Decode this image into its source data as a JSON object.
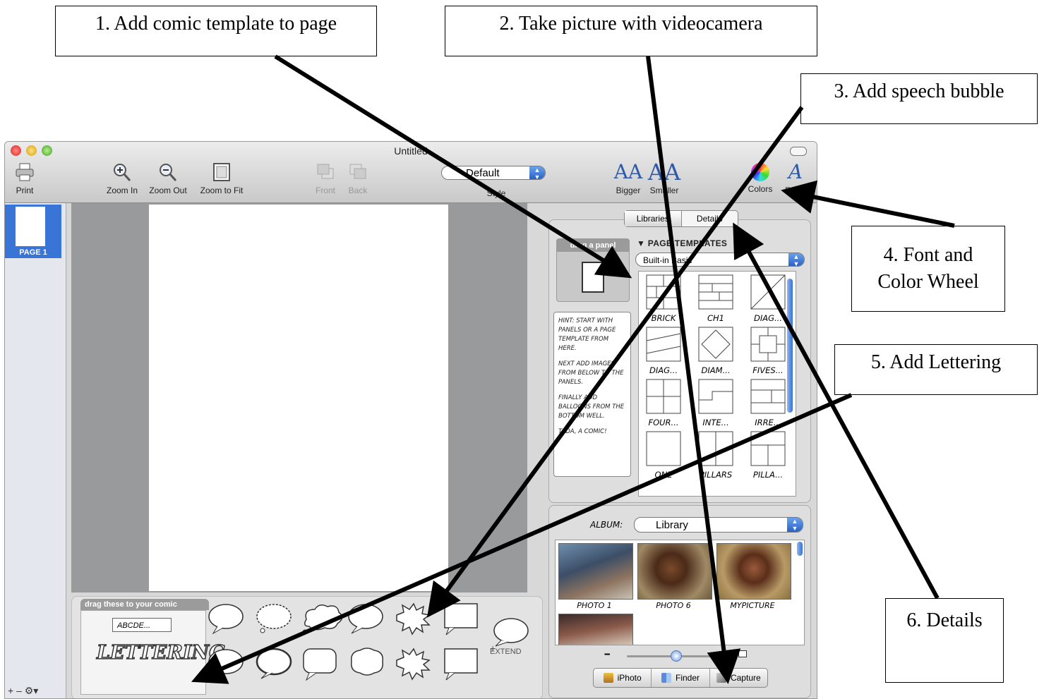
{
  "callouts": {
    "c1": "1. Add comic template to page",
    "c2": "2. Take picture with videocamera",
    "c3": "3. Add speech bubble",
    "c4": "4. Font and Color Wheel",
    "c5": "5. Add Lettering",
    "c6": "6. Details"
  },
  "window": {
    "title": "Untitled"
  },
  "toolbar": {
    "print": "Print",
    "zoom_in": "Zoom In",
    "zoom_out": "Zoom Out",
    "zoom_fit": "Zoom to Fit",
    "front": "Front",
    "back": "Back",
    "style_value": "Default",
    "style_label": "Style",
    "bigger": "Bigger",
    "smaller": "Smaller",
    "colors": "Colors",
    "fonts": "Fonts"
  },
  "sidebar": {
    "page_label": "PAGE 1",
    "controls": "+  –  ⚙▾"
  },
  "well": {
    "tab": "drag these to your comic",
    "abcde": "ABCDE...",
    "lettering": "LETTERING",
    "extend": "EXTEND"
  },
  "libraries": {
    "tab_libraries": "Libraries",
    "tab_details": "Details",
    "drag_panel": "drag a panel",
    "page_templates": "▼ PAGE TEMPLATES",
    "template_set": "Built-in Basic",
    "hint": [
      "HINT: START WITH PANELS OR A PAGE TEMPLATE FROM HERE.",
      "NEXT ADD IMAGES FROM BELOW TO THE PANELS.",
      "FINALLY ADD BALLOONS FROM THE BOTTOM WELL.",
      "TADA, A COMIC!"
    ],
    "templates": [
      "BRICK",
      "CH1",
      "DIAG...",
      "DIAG...",
      "DIAM...",
      "FIVES...",
      "FOUR...",
      "INTE...",
      "IRRE...",
      "ONE",
      "PILLARS",
      "PILLA..."
    ]
  },
  "photos": {
    "album_label": "ALBUM:",
    "album_value": "Library",
    "items": [
      "PHOTO 1",
      "PHOTO 6",
      "MYPICTURE"
    ],
    "buttons": [
      "iPhoto",
      "Finder",
      "Capture"
    ]
  }
}
